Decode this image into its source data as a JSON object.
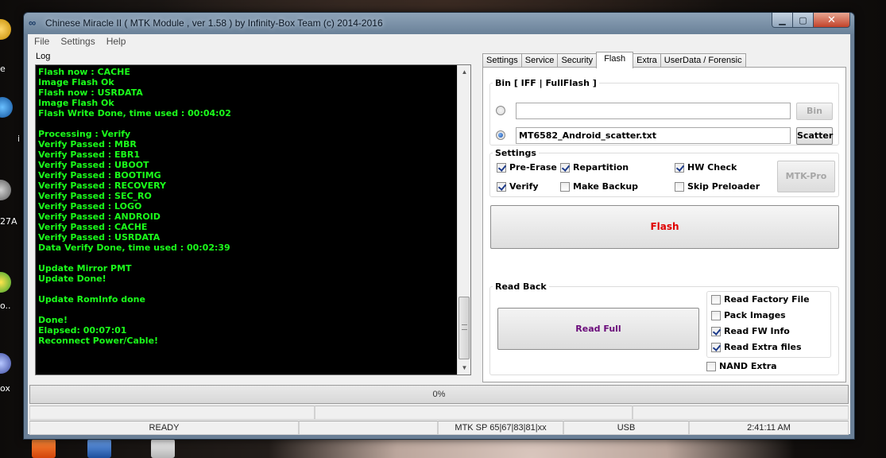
{
  "window": {
    "title": "Chinese Miracle II ( MTK Module , ver 1.58 ) by Infinity-Box Team (c) 2014-2016"
  },
  "menu": [
    "File",
    "Settings",
    "Help"
  ],
  "log": {
    "label": "Log",
    "lines": [
      "Flash now : CACHE",
      "Image Flash Ok",
      "Flash now : USRDATA",
      "Image Flash Ok",
      "Flash Write Done, time used : 00:04:02",
      "",
      "Processing : Verify",
      "Verify Passed : MBR",
      "Verify Passed : EBR1",
      "Verify Passed : UBOOT",
      "Verify Passed : BOOTIMG",
      "Verify Passed : RECOVERY",
      "Verify Passed : SEC_RO",
      "Verify Passed : LOGO",
      "Verify Passed : ANDROID",
      "Verify Passed : CACHE",
      "Verify Passed : USRDATA",
      "Data Verify Done, time used : 00:02:39",
      "",
      "Update Mirror PMT",
      "Update Done!",
      "",
      "Update RomInfo done",
      "",
      "Done!",
      "Elapsed: 00:07:01",
      "Reconnect Power/Cable!"
    ]
  },
  "tabs": [
    {
      "label": "Settings",
      "active": false
    },
    {
      "label": "Service",
      "active": false
    },
    {
      "label": "Security",
      "active": false
    },
    {
      "label": "Flash",
      "active": true
    },
    {
      "label": "Extra",
      "active": false
    },
    {
      "label": "UserData / Forensic",
      "active": false
    }
  ],
  "bin_group": {
    "label": "Bin  [ IFF | FullFlash ]",
    "bin_value": "",
    "bin_button": "Bin",
    "scatter_value": "MT6582_Android_scatter.txt",
    "scatter_button": "Scatter",
    "selected": "scatter"
  },
  "settings_group": {
    "label": "Settings",
    "options": [
      {
        "label": "Pre-Erase",
        "checked": true
      },
      {
        "label": "Repartition",
        "checked": true
      },
      {
        "label": "HW Check",
        "checked": true
      },
      {
        "label": "Verify",
        "checked": true
      },
      {
        "label": "Make Backup",
        "checked": false
      },
      {
        "label": "Skip Preloader",
        "checked": false
      }
    ],
    "mtk_pro_button": "MTK-Pro"
  },
  "flash_button": {
    "label": "Flash",
    "color": "#e00000"
  },
  "readback_group": {
    "label": "Read Back",
    "read_full_button": "Read Full",
    "read_full_color": "#6a0a7a",
    "options": [
      {
        "label": "Read Factory File",
        "checked": false
      },
      {
        "label": "Pack Images",
        "checked": false
      },
      {
        "label": "Read FW Info",
        "checked": true
      },
      {
        "label": "Read Extra files",
        "checked": true
      }
    ],
    "nand_extra": {
      "label": "NAND Extra",
      "checked": false
    }
  },
  "progress": {
    "text": "0%",
    "value": 0
  },
  "status": [
    "READY",
    "",
    "MTK SP 65|67|83|81|xx",
    "USB",
    "2:41:11 AM"
  ],
  "desktop": {
    "labels": [
      "e",
      "i",
      "27A",
      "o..",
      "ox"
    ]
  }
}
